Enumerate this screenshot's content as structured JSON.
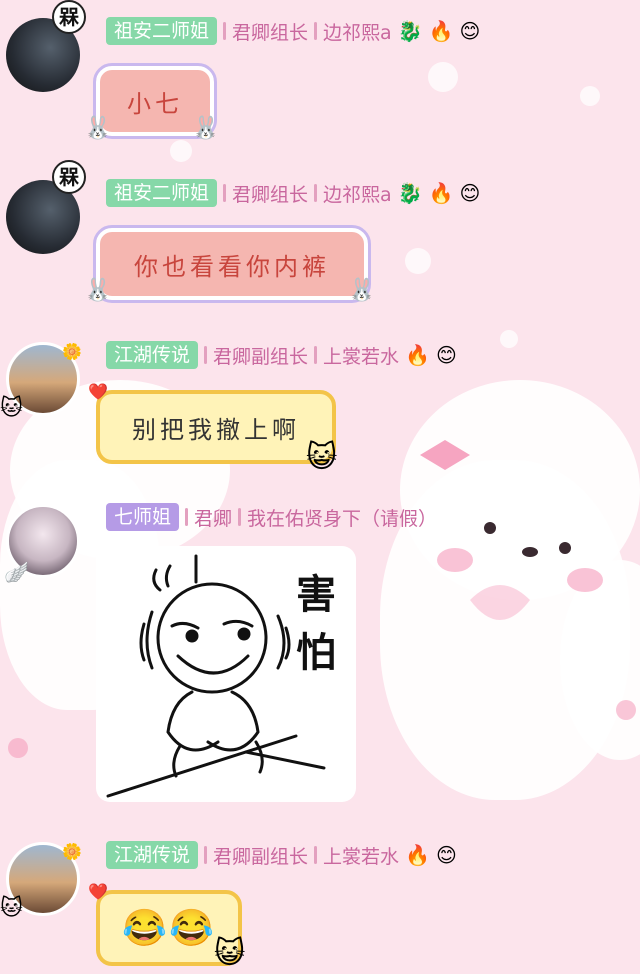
{
  "messages": [
    {
      "sender_tag": "祖安二师姐",
      "rank": "君卿组长",
      "nickname": "边祁熙a",
      "badge": "槑",
      "emojis": [
        "🐉",
        "🔥",
        "😊"
      ],
      "text": "小七"
    },
    {
      "sender_tag": "祖安二师姐",
      "rank": "君卿组长",
      "nickname": "边祁熙a",
      "badge": "槑",
      "emojis": [
        "🐉",
        "🔥",
        "😊"
      ],
      "text": "你也看看你内裤"
    },
    {
      "sender_tag": "江湖传说",
      "rank": "君卿副组长",
      "nickname": "上裳若水",
      "emojis": [
        "🔥",
        "😊"
      ],
      "text": "别把我撤上啊"
    },
    {
      "sender_tag": "七师姐",
      "rank": "君卿",
      "nickname": "我在佑贤身下（请假）",
      "sticker_text": "害怕"
    },
    {
      "sender_tag": "江湖传说",
      "rank": "君卿副组长",
      "nickname": "上裳若水",
      "emojis": [
        "🔥",
        "😊"
      ],
      "text": "😂😂"
    }
  ],
  "colors": {
    "background": "#fce4ec",
    "tag_green": "#86d8a8",
    "tag_purple": "#b59be6",
    "rank_text": "#c9679e",
    "pink_bubble": "#f5b6b0",
    "yellow_bubble": "#fff3b8"
  }
}
